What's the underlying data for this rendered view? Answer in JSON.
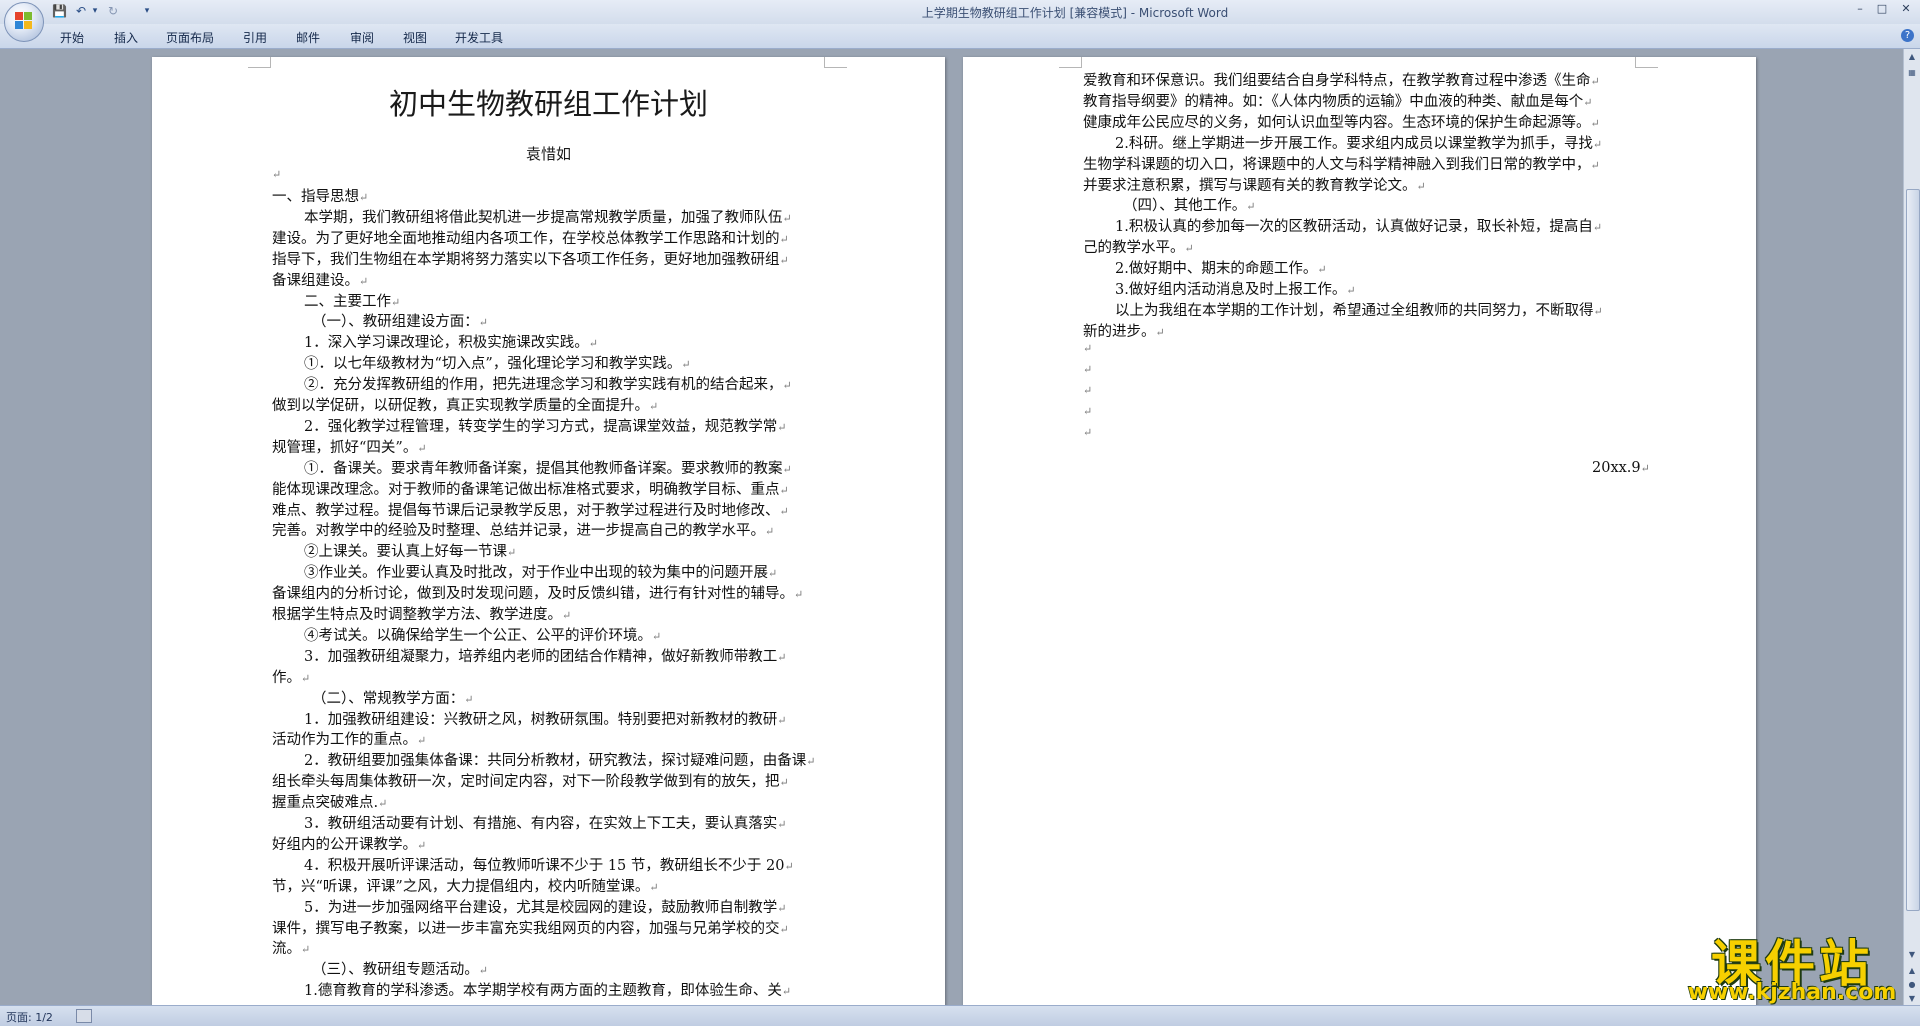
{
  "window": {
    "title": "上学期生物教研组工作计划 [兼容模式] - Microsoft Word",
    "controls": [
      "–",
      "□",
      "✕"
    ]
  },
  "ribbon": {
    "tabs": [
      "开始",
      "插入",
      "页面布局",
      "引用",
      "邮件",
      "审阅",
      "视图",
      "开发工具"
    ]
  },
  "document": {
    "title": "初中生物教研组工作计划",
    "author": "袁惜如",
    "page1_lines": [
      "一、指导思想",
      "本学期，我们教研组将借此契机进一步提高常规教学质量，加强了教师队伍",
      "建设。为了更好地全面地推动组内各项工作，在学校总体教学工作思路和计划的",
      "指导下，我们生物组在本学期将努力落实以下各项工作任务，更好地加强教研组",
      "备课组建设。",
      "二、主要工作",
      "（一）、教研组建设方面：",
      "1．深入学习课改理论，积极实施课改实践。",
      "①．以七年级教材为“切入点”，强化理论学习和教学实践。",
      "②．充分发挥教研组的作用，把先进理念学习和教学实践有机的结合起来，",
      "做到以学促研，以研促教，真正实现教学质量的全面提升。",
      "2．强化教学过程管理，转变学生的学习方式，提高课堂效益，规范教学常",
      "规管理，抓好“四关”。",
      "①．备课关。要求青年教师备详案，提倡其他教师备详案。要求教师的教案",
      "能体现课改理念。对于教师的备课笔记做出标准格式要求，明确教学目标、重点",
      "难点、教学过程。提倡每节课后记录教学反思，对于教学过程进行及时地修改、",
      "完善。对教学中的经验及时整理、总结并记录，进一步提高自己的教学水平。",
      "②上课关。要认真上好每一节课",
      "③作业关。作业要认真及时批改，对于作业中出现的较为集中的问题开展",
      "备课组内的分析讨论，做到及时发现问题，及时反馈纠错，进行有针对性的辅导。",
      "根据学生特点及时调整教学方法、教学进度。",
      "④考试关。以确保给学生一个公正、公平的评价环境。",
      "3．加强教研组凝聚力，培养组内老师的团结合作精神，做好新教师带教工",
      "作。",
      "（二）、常规教学方面：",
      "1．加强教研组建设：兴教研之风，树教研氛围。特别要把对新教材的教研",
      "活动作为工作的重点。",
      "2．教研组要加强集体备课：共同分析教材，研究教法，探讨疑难问题，由备课",
      "组长牵头每周集体教研一次，定时间定内容，对下一阶段教学做到有的放矢，把",
      "握重点突破难点.",
      "3．教研组活动要有计划、有措施、有内容，在实效上下工夫，要认真落实",
      "好组内的公开课教学。",
      "4．积极开展听评课活动，每位教师听课不少于 15 节，教研组长不少于 20",
      "节，兴“听课，评课”之风，大力提倡组内，校内听随堂课。",
      "5．为进一步加强网络平台建设，尤其是校园网的建设，鼓励教师自制教学",
      "课件，撰写电子教案，以进一步丰富充实我组网页的内容，加强与兄弟学校的交",
      "流。",
      "（三）、教研组专题活动。",
      "1.德育教育的学科渗透。本学期学校有两方面的主题教育，即体验生命、关"
    ],
    "page2_lines": [
      "爱教育和环保意识。我们组要结合自身学科特点，在教学教育过程中渗透《生命",
      "教育指导纲要》的精神。如：《人体内物质的运输》中血液的种类、献血是每个",
      "健康成年公民应尽的义务，如何认识血型等内容。生态环境的保护生命起源等。",
      "2.科研。继上学期进一步开展工作。要求组内成员以课堂教学为抓手，寻找",
      "生物学科课题的切入口，将课题中的人文与科学精神融入到我们日常的教学中，",
      "并要求注意积累，撰写与课题有关的教育教学论文。",
      "（四）、其他工作。",
      "1.积极认真的参加每一次的区教研活动，认真做好记录，取长补短，提高自",
      "己的教学水平。",
      "2.做好期中、期末的命题工作。",
      "3.做好组内活动消息及时上报工作。",
      "以上为我组在本学期的工作计划，希望通过全组教师的共同努力，不断取得",
      "新的进步。"
    ],
    "date": "20xx.9"
  },
  "statusbar": {
    "page": "页面: 1/2"
  },
  "watermark": {
    "text": "课件站",
    "url": "www.kjzhan.com"
  }
}
